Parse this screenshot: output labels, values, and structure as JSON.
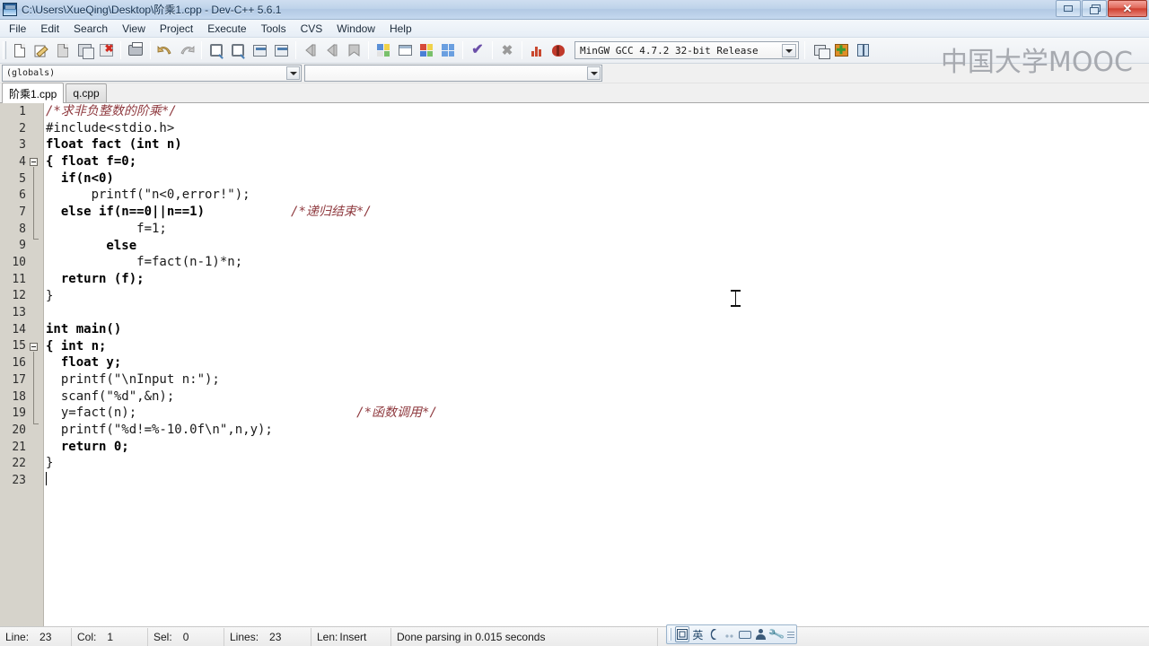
{
  "window": {
    "title": "C:\\Users\\XueQing\\Desktop\\阶乘1.cpp - Dev-C++ 5.6.1",
    "app_icon": "devcpp-icon",
    "controls": {
      "minimize": "minimize-icon",
      "restore": "restore-icon",
      "close": "✕"
    }
  },
  "menubar": {
    "items": [
      {
        "label": "File"
      },
      {
        "label": "Edit"
      },
      {
        "label": "Search"
      },
      {
        "label": "View"
      },
      {
        "label": "Project"
      },
      {
        "label": "Execute"
      },
      {
        "label": "Tools"
      },
      {
        "label": "CVS"
      },
      {
        "label": "Window"
      },
      {
        "label": "Help"
      }
    ]
  },
  "toolbar": {
    "buttons": [
      {
        "name": "new-file-icon"
      },
      {
        "name": "open-file-icon"
      },
      {
        "name": "save-icon"
      },
      {
        "name": "save-all-icon"
      },
      {
        "name": "close-file-icon"
      },
      {
        "name": "print-icon"
      },
      {
        "name": "undo-icon"
      },
      {
        "name": "redo-icon"
      },
      {
        "name": "find-icon"
      },
      {
        "name": "replace-icon"
      },
      {
        "name": "goto-line-icon"
      },
      {
        "name": "goto-function-icon"
      },
      {
        "name": "back-icon"
      },
      {
        "name": "forward-icon"
      },
      {
        "name": "bookmark-icon"
      },
      {
        "name": "compile-icon"
      },
      {
        "name": "run-icon"
      },
      {
        "name": "compile-run-icon"
      },
      {
        "name": "rebuild-all-icon"
      },
      {
        "name": "syntax-check-icon"
      },
      {
        "name": "stop-execution-icon"
      },
      {
        "name": "profile-icon"
      },
      {
        "name": "debug-icon"
      }
    ],
    "compiler": {
      "label": "MinGW GCC 4.7.2 32-bit Release",
      "arrow": "chevron-down-icon"
    },
    "right_buttons": [
      {
        "name": "new-window-icon"
      },
      {
        "name": "add-to-project-icon"
      },
      {
        "name": "help-book-icon"
      }
    ]
  },
  "watermark": {
    "text": "中国大学MOOC",
    "color": "#a4a7ad"
  },
  "browserbar": {
    "scope_combo": {
      "value": "(globals)",
      "arrow": "chevron-down-icon"
    },
    "member_combo": {
      "value": "",
      "arrow": "chevron-down-icon"
    }
  },
  "tabs": [
    {
      "label": "阶乘1.cpp",
      "active": true
    },
    {
      "label": "q.cpp",
      "active": false
    }
  ],
  "editor": {
    "line_numbers": [
      "1",
      "2",
      "3",
      "4",
      "5",
      "6",
      "7",
      "8",
      "9",
      "10",
      "11",
      "12",
      "13",
      "14",
      "15",
      "16",
      "17",
      "18",
      "19",
      "20",
      "21",
      "22",
      "23"
    ],
    "lines": [
      {
        "n": 1,
        "text": "/*求非负整数的阶乘*/",
        "indent": 0,
        "style": "comment"
      },
      {
        "n": 2,
        "text": "#include<stdio.h>",
        "indent": 0,
        "style": "plain"
      },
      {
        "n": 3,
        "text": "float fact (int n)",
        "indent": 0,
        "style": "mixed"
      },
      {
        "n": 4,
        "text": "{ float f=0;",
        "indent": 0,
        "style": "mixed"
      },
      {
        "n": 5,
        "text": "  if(n<0)",
        "indent": 0,
        "style": "mixed"
      },
      {
        "n": 6,
        "text": "      printf(\"n<0,error!\");",
        "indent": 0,
        "style": "plain"
      },
      {
        "n": 7,
        "text": "  else if(n==0||n==1)",
        "indent": 0,
        "style": "mixed"
      },
      {
        "n": 8,
        "text": "            f=1;",
        "indent": 0,
        "style": "plain"
      },
      {
        "n": 9,
        "text": "        else",
        "indent": 0,
        "style": "mixed"
      },
      {
        "n": 10,
        "text": "            f=fact(n-1)*n;",
        "indent": 0,
        "style": "plain"
      },
      {
        "n": 11,
        "text": "  return (f);",
        "indent": 0,
        "style": "mixed"
      },
      {
        "n": 12,
        "text": "}",
        "indent": 0,
        "style": "plain"
      },
      {
        "n": 13,
        "text": "",
        "indent": 0,
        "style": "plain"
      },
      {
        "n": 14,
        "text": "int main()",
        "indent": 0,
        "style": "mixed"
      },
      {
        "n": 15,
        "text": "{ int n;",
        "indent": 0,
        "style": "mixed"
      },
      {
        "n": 16,
        "text": "  float y;",
        "indent": 0,
        "style": "mixed"
      },
      {
        "n": 17,
        "text": "  printf(\"\\nInput n:\");",
        "indent": 0,
        "style": "plain"
      },
      {
        "n": 18,
        "text": "  scanf(\"%d\",&n);",
        "indent": 0,
        "style": "plain"
      },
      {
        "n": 19,
        "text": "  y=fact(n);",
        "indent": 0,
        "style": "plain"
      },
      {
        "n": 20,
        "text": "  printf(\"%d!=%-10.0f\\n\",n,y);",
        "indent": 0,
        "style": "plain"
      },
      {
        "n": 21,
        "text": "  return 0;",
        "indent": 0,
        "style": "mixed"
      },
      {
        "n": 22,
        "text": "}",
        "indent": 0,
        "style": "plain"
      },
      {
        "n": 23,
        "text": "",
        "indent": 0,
        "style": "plain"
      }
    ],
    "inline_comments": [
      {
        "line": 7,
        "text": "/*递归结束*/"
      },
      {
        "line": 19,
        "text": "/*函数调用*/"
      }
    ],
    "fold_markers": [
      {
        "line": 4,
        "state": "expanded"
      },
      {
        "line": 15,
        "state": "expanded"
      }
    ],
    "caret": {
      "line": 23,
      "col": 1
    },
    "colors": {
      "comment": "#8f3a3f",
      "keyword": "#000000",
      "text": "#1a1a1a",
      "gutter_bg": "#d6d3cb"
    }
  },
  "statusbar": {
    "line_key": "Line:",
    "line_value": "23",
    "col_key": "Col:",
    "col_value": "1",
    "sel_key": "Sel:",
    "sel_value": "0",
    "lines_key": "Lines:",
    "lines_value": "23",
    "len_key": "Len:",
    "insert_mode": "Insert",
    "message": "Done parsing in 0.015 seconds"
  },
  "ime": {
    "mode_icon": "ime-mode-icon",
    "language": "英",
    "shape_icon": "half-width-icon",
    "punctuation_icon": "punctuation-icon",
    "keyboard_icon": "soft-keyboard-icon",
    "user_icon": "user-dictionary-icon",
    "tools_icon": "wrench-icon"
  }
}
